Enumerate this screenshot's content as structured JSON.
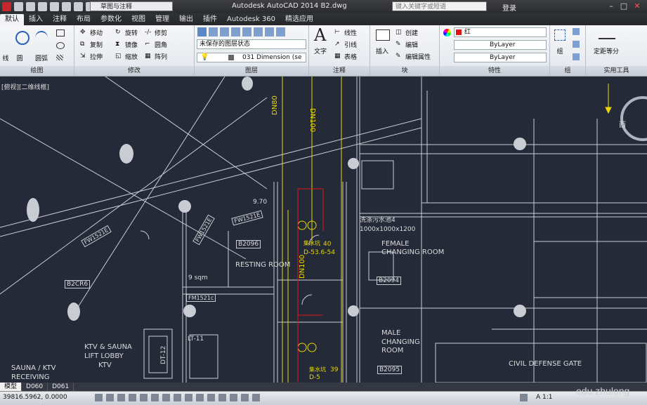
{
  "titlebar": {
    "workspace": "草图与注释",
    "app_title": "Autodesk AutoCAD 2014    B2.dwg",
    "search_placeholder": "键入关键字或短语",
    "login": "登录"
  },
  "tabs": [
    "默认",
    "插入",
    "注释",
    "布局",
    "参数化",
    "视图",
    "管理",
    "输出",
    "插件",
    "Autodesk 360",
    "精选应用"
  ],
  "ribbon": {
    "draw": {
      "title": "绘图",
      "line": "线",
      "circle": "圆",
      "arc": "圆弧"
    },
    "modify": {
      "title": "修改",
      "move": "移动",
      "rotate": "旋转",
      "trim": "修剪",
      "copy": "复制",
      "mirror": "镜像",
      "fillet": "圆角",
      "stretch": "拉伸",
      "scale": "缩放",
      "array": "阵列"
    },
    "layers": {
      "title": "图层",
      "layer_state": "未保存的图层状态",
      "current_layer": "031 Dimension (se"
    },
    "annotation": {
      "title": "注释",
      "text": "文字",
      "linear": "线性",
      "leader": "引线",
      "table": "表格"
    },
    "block": {
      "title": "块",
      "insert": "插入",
      "create": "创建",
      "edit": "编辑",
      "edit_attr": "编辑属性"
    },
    "properties": {
      "title": "特性",
      "color": "红",
      "linetype": "ByLayer",
      "lineweight": "ByLayer"
    },
    "groups": {
      "title": "组",
      "group": "组"
    },
    "utilities": {
      "title": "实用工具",
      "measure": "定距等分"
    }
  },
  "view_label": "[俯视][二维线框]",
  "drawing_text": {
    "dn80": "DN80",
    "dn100_top": "DN100",
    "dn100_mid": "DN100",
    "wash_pool": "洗涤污水池4",
    "wash_dims": "1000x1000x1200",
    "female": "FEMALE",
    "changing_room_f": "CHANGING ROOM",
    "b2094": "B2094",
    "resting": "RESTING ROOM",
    "b2096": "B2096",
    "area": "9 sqm",
    "male": "MALE",
    "changing": "CHANGING",
    "room": "ROOM",
    "b2095": "B2095",
    "ktv_sauna": "KTV & SAUNA",
    "lift_lobby": "LIFT LOBBY",
    "ktv": "KTV",
    "sauna_ktv": "SAUNA / KTV",
    "receiving": "RECEIVING",
    "civil": "CIVIL DEFENSE GATE",
    "pump1": "集水坑",
    "pump1_val": "40",
    "pump1_d": "D-53.6-54",
    "pump2": "集水坑",
    "pump2_val": "39",
    "pump2_d": "D-5",
    "fw1": "FW1521E",
    "fw2": "FW1521E",
    "fw3": "FW1521E",
    "fm4": "FM1521c",
    "dim": "9.70",
    "b2c": "B2CR6",
    "west": "西",
    "lt11": "LT-11",
    "dt12": "DT-12"
  },
  "layout_tabs": [
    "模型",
    "D060",
    "D061"
  ],
  "status": {
    "coords": "39816.5962, 0.0000",
    "scale": "A 1:1"
  },
  "watermark": "edu.zhulong",
  "colors": {
    "accent_red": "#e01515",
    "line_yellow": "#e8d800",
    "wire_white": "#c9ccd3",
    "bg": "#242a38"
  }
}
